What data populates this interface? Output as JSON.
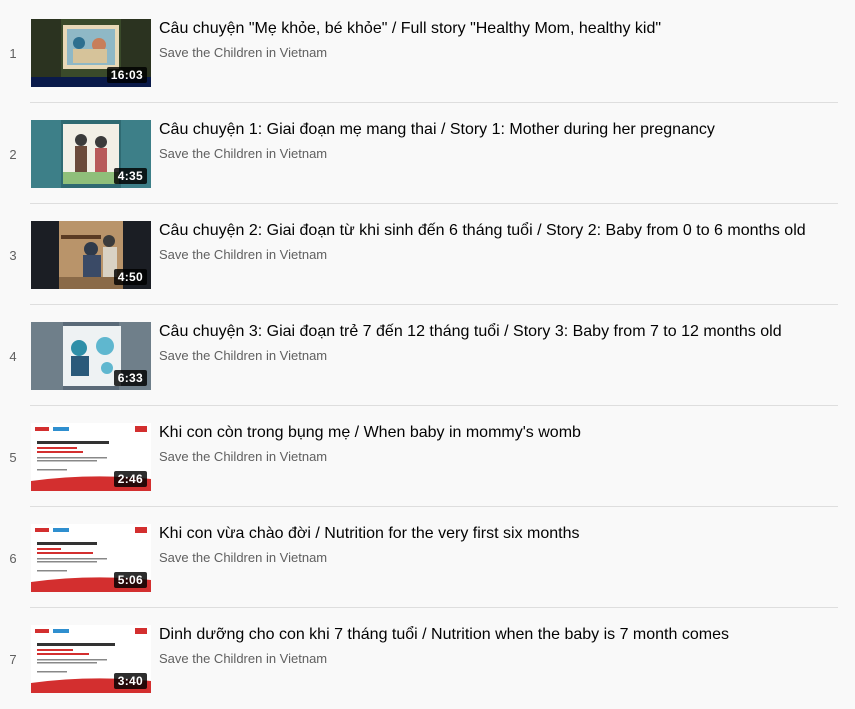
{
  "playlist": {
    "items": [
      {
        "index": "1",
        "title": "Câu chuyện \"Mẹ khỏe, bé khỏe\" / Full story \"Healthy Mom, healthy kid\"",
        "channel": "Save the Children in Vietnam",
        "duration": "16:03"
      },
      {
        "index": "2",
        "title": "Câu chuyện 1: Giai đoạn mẹ mang thai / Story 1: Mother during her pregnancy",
        "channel": "Save the Children in Vietnam",
        "duration": "4:35"
      },
      {
        "index": "3",
        "title": "Câu chuyện 2: Giai đoạn từ khi sinh đến 6 tháng tuổi / Story 2: Baby from 0 to 6 months old",
        "channel": "Save the Children in Vietnam",
        "duration": "4:50"
      },
      {
        "index": "4",
        "title": "Câu chuyện 3: Giai đoạn trẻ 7 đến 12 tháng tuổi / Story 3: Baby from 7 to 12 months old",
        "channel": "Save the Children in Vietnam",
        "duration": "6:33"
      },
      {
        "index": "5",
        "title": "Khi con còn trong bụng mẹ / When baby in mommy's womb",
        "channel": "Save the Children in Vietnam",
        "duration": "2:46"
      },
      {
        "index": "6",
        "title": "Khi con vừa chào đời / Nutrition for the very first six months",
        "channel": "Save the Children in Vietnam",
        "duration": "5:06"
      },
      {
        "index": "7",
        "title": "Dinh dưỡng cho con khi 7 tháng tuổi / Nutrition when the baby is 7 month comes",
        "channel": "Save the Children in Vietnam",
        "duration": "3:40"
      }
    ]
  }
}
